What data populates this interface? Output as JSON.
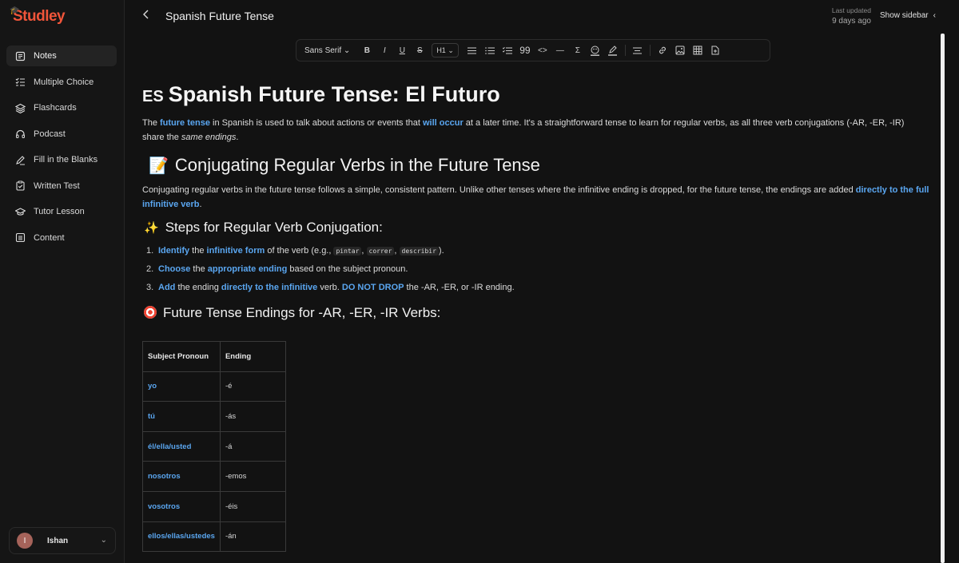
{
  "app": {
    "logo": "Studley"
  },
  "sidebar": {
    "items": [
      {
        "label": "Notes",
        "icon": "notes-icon",
        "active": true
      },
      {
        "label": "Multiple Choice",
        "icon": "list-check-icon"
      },
      {
        "label": "Flashcards",
        "icon": "layers-icon"
      },
      {
        "label": "Podcast",
        "icon": "headphones-icon"
      },
      {
        "label": "Fill in the Blanks",
        "icon": "pencil-icon"
      },
      {
        "label": "Written Test",
        "icon": "clipboard-check-icon"
      },
      {
        "label": "Tutor Lesson",
        "icon": "graduation-cap-icon"
      },
      {
        "label": "Content",
        "icon": "document-icon"
      }
    ],
    "user": {
      "initial": "I",
      "name": "Ishan"
    }
  },
  "header": {
    "title": "Spanish Future Tense",
    "last_updated_label": "Last updated",
    "last_updated_value": "9 days ago",
    "show_sidebar": "Show sidebar"
  },
  "toolbar": {
    "font": "Sans Serif",
    "heading": "H1",
    "bold": "B",
    "italic": "I",
    "underline": "U",
    "strike": "S",
    "sigma": "Σ"
  },
  "doc": {
    "h1_flag": "ES",
    "h1": "Spanish Future Tense: El Futuro",
    "p1": {
      "a": "The ",
      "b": "future tense",
      "c": " in Spanish is used to talk about actions or events that ",
      "d": "will occur",
      "e": " at a later time. It's a straightforward tense to learn for regular verbs, as all three verb conjugations (-AR, -ER, -IR) share the ",
      "f": "same endings",
      "g": "."
    },
    "h2": "Conjugating Regular Verbs in the Future Tense",
    "p2": {
      "a": "Conjugating regular verbs in the future tense follows a simple, consistent pattern. Unlike other tenses where the infinitive ending is dropped, for the future tense, the endings are added ",
      "b": "directly to the full infinitive verb",
      "c": "."
    },
    "h3": "Steps for Regular Verb Conjugation:",
    "steps": {
      "s1": {
        "num": "1.",
        "a": "Identify",
        "b": " the ",
        "c": "infinitive form",
        "d": " of the verb (e.g., ",
        "code1": "pintar",
        "sep1": ", ",
        "code2": "correr",
        "sep2": ", ",
        "code3": "describir",
        "e": ")."
      },
      "s2": {
        "num": "2.",
        "a": "Choose",
        "b": " the ",
        "c": "appropriate ending",
        "d": " based on the subject pronoun."
      },
      "s3": {
        "num": "3.",
        "a": "Add",
        "b": " the ending ",
        "c": "directly to the infinitive",
        "d": " verb. ",
        "e": "DO NOT DROP",
        "f": " the -AR, -ER, or -IR ending."
      }
    },
    "h4": "Future Tense Endings for -AR, -ER, -IR Verbs:",
    "table": {
      "headers": [
        "Subject Pronoun",
        "Ending"
      ],
      "rows": [
        [
          "yo",
          "-é"
        ],
        [
          "tú",
          "-ás"
        ],
        [
          "él/ella/usted",
          "-á"
        ],
        [
          "nosotros",
          "-emos"
        ],
        [
          "vosotros",
          "-éis"
        ],
        [
          "ellos/ellas/ustedes",
          "-án"
        ]
      ]
    }
  }
}
